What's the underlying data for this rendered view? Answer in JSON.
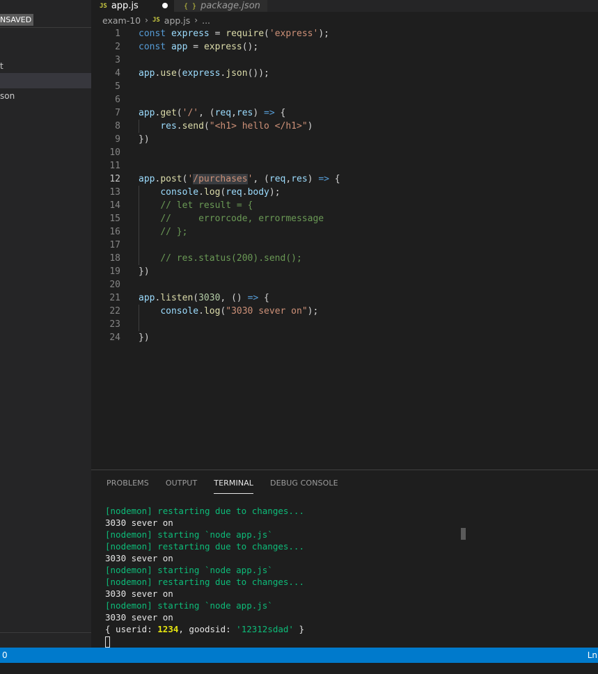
{
  "sidebar": {
    "more_icon": "ellipsis-icon",
    "unsaved_label": "NSAVED",
    "fragment_1": "t",
    "fragment_2": "son"
  },
  "tabs": [
    {
      "icon": "JS",
      "label": "app.js",
      "modified": true
    },
    {
      "icon": "{ }",
      "label": "package.json"
    }
  ],
  "breadcrumb": {
    "folder": "exam-10",
    "file_icon": "JS",
    "file": "app.js",
    "more": "..."
  },
  "editor": {
    "active_line": 12,
    "lines": [
      [
        [
          "kw",
          "const "
        ],
        [
          "var",
          "express"
        ],
        [
          "pl",
          " = "
        ],
        [
          "fn",
          "require"
        ],
        [
          "pl",
          "("
        ],
        [
          "str",
          "'express'"
        ],
        [
          "pl",
          ");"
        ]
      ],
      [
        [
          "kw",
          "const "
        ],
        [
          "var",
          "app"
        ],
        [
          "pl",
          " = "
        ],
        [
          "fn",
          "express"
        ],
        [
          "pl",
          "();"
        ]
      ],
      [],
      [
        [
          "var",
          "app"
        ],
        [
          "pl",
          "."
        ],
        [
          "fn",
          "use"
        ],
        [
          "pl",
          "("
        ],
        [
          "var",
          "express"
        ],
        [
          "pl",
          "."
        ],
        [
          "fn",
          "json"
        ],
        [
          "pl",
          "());"
        ]
      ],
      [],
      [],
      [
        [
          "var",
          "app"
        ],
        [
          "pl",
          "."
        ],
        [
          "fn",
          "get"
        ],
        [
          "pl",
          "("
        ],
        [
          "str",
          "'/'"
        ],
        [
          "pl",
          ", ("
        ],
        [
          "var",
          "req"
        ],
        [
          "pl",
          ","
        ],
        [
          "var",
          "res"
        ],
        [
          "pl",
          ") "
        ],
        [
          "kw",
          "=>"
        ],
        [
          "pl",
          " {"
        ]
      ],
      [
        [
          "pl",
          "    "
        ],
        [
          "var",
          "res"
        ],
        [
          "pl",
          "."
        ],
        [
          "fn",
          "send"
        ],
        [
          "pl",
          "("
        ],
        [
          "str",
          "\"<h1> hello </h1>\""
        ],
        [
          "pl",
          ")"
        ]
      ],
      [
        [
          "pl",
          "})"
        ]
      ],
      [],
      [],
      [
        [
          "var",
          "app"
        ],
        [
          "pl",
          "."
        ],
        [
          "fn",
          "post"
        ],
        [
          "pl",
          "("
        ],
        [
          "str",
          "'"
        ],
        [
          "hl",
          "/purchases"
        ],
        [
          "str",
          "'"
        ],
        [
          "pl",
          ", ("
        ],
        [
          "var",
          "req"
        ],
        [
          "pl",
          ","
        ],
        [
          "var",
          "res"
        ],
        [
          "pl",
          ") "
        ],
        [
          "kw",
          "=>"
        ],
        [
          "pl",
          " {"
        ]
      ],
      [
        [
          "pl",
          "    "
        ],
        [
          "var",
          "console"
        ],
        [
          "pl",
          "."
        ],
        [
          "fn",
          "log"
        ],
        [
          "pl",
          "("
        ],
        [
          "var",
          "req"
        ],
        [
          "pl",
          "."
        ],
        [
          "var",
          "body"
        ],
        [
          "pl",
          ");"
        ]
      ],
      [
        [
          "pl",
          "    "
        ],
        [
          "cm",
          "// let result = {"
        ]
      ],
      [
        [
          "pl",
          "    "
        ],
        [
          "cm",
          "//     errorcode, errormessage"
        ]
      ],
      [
        [
          "pl",
          "    "
        ],
        [
          "cm",
          "// };"
        ]
      ],
      [],
      [
        [
          "pl",
          "    "
        ],
        [
          "cm",
          "// res.status(200).send();"
        ]
      ],
      [
        [
          "pl",
          "})"
        ]
      ],
      [],
      [
        [
          "var",
          "app"
        ],
        [
          "pl",
          "."
        ],
        [
          "fn",
          "listen"
        ],
        [
          "pl",
          "("
        ],
        [
          "num",
          "3030"
        ],
        [
          "pl",
          ", () "
        ],
        [
          "kw",
          "=>"
        ],
        [
          "pl",
          " {"
        ]
      ],
      [
        [
          "pl",
          "    "
        ],
        [
          "var",
          "console"
        ],
        [
          "pl",
          "."
        ],
        [
          "fn",
          "log"
        ],
        [
          "pl",
          "("
        ],
        [
          "str",
          "\"3030 sever on\""
        ],
        [
          "pl",
          ");"
        ]
      ],
      [],
      [
        [
          "pl",
          "})"
        ]
      ]
    ]
  },
  "panel": {
    "tabs": [
      "PROBLEMS",
      "OUTPUT",
      "TERMINAL",
      "DEBUG CONSOLE"
    ],
    "active_tab": "TERMINAL",
    "terminal": [
      {
        "kind": "green",
        "text": "[nodemon] restarting due to changes..."
      },
      {
        "kind": "white",
        "text": "3030 sever on"
      },
      {
        "kind": "green",
        "text": "[nodemon] starting `node app.js`"
      },
      {
        "kind": "green",
        "text": "[nodemon] restarting due to changes..."
      },
      {
        "kind": "white",
        "text": "3030 sever on"
      },
      {
        "kind": "green",
        "text": "[nodemon] starting `node app.js`"
      },
      {
        "kind": "green",
        "text": "[nodemon] restarting due to changes..."
      },
      {
        "kind": "white",
        "text": "3030 sever on"
      },
      {
        "kind": "green",
        "text": "[nodemon] starting `node app.js`"
      },
      {
        "kind": "white",
        "text": "3030 sever on"
      }
    ],
    "object_line": {
      "open": "{ userid: ",
      "userid": "1234",
      "middle": ", goodsid: ",
      "goodsid": "'12312sdad'",
      "close": " }"
    }
  },
  "status": {
    "left": "0",
    "right": "Ln"
  },
  "colors": {
    "status_bar": "#007acc",
    "editor_bg": "#1e1e1e",
    "sidebar_bg": "#252526",
    "terminal_green": "#0dbc79"
  }
}
